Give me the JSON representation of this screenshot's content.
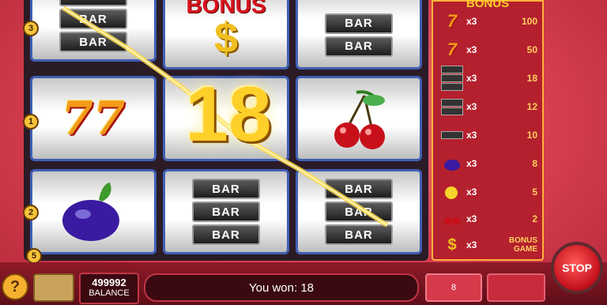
{
  "reels": {
    "bar_label": "BAR",
    "bonus_word": "BONUS",
    "dollar": "$",
    "sevens": "77",
    "win_overlay": "18"
  },
  "line_markers": [
    "3",
    "1",
    "2",
    "5"
  ],
  "paytable": {
    "title": "BONUS",
    "rows": [
      {
        "symbol": "triple-seven",
        "mult": "x3",
        "value": "100"
      },
      {
        "symbol": "seven",
        "mult": "x3",
        "value": "50"
      },
      {
        "symbol": "triple-bar",
        "mult": "x3",
        "value": "18"
      },
      {
        "symbol": "double-bar",
        "mult": "x3",
        "value": "12"
      },
      {
        "symbol": "single-bar",
        "mult": "x3",
        "value": "10"
      },
      {
        "symbol": "plum",
        "mult": "x3",
        "value": "8"
      },
      {
        "symbol": "lemon",
        "mult": "x3",
        "value": "5"
      },
      {
        "symbol": "cherry",
        "mult": "x3",
        "value": "2"
      },
      {
        "symbol": "bonus-dollar",
        "mult": "x3",
        "value": "BONUS GAME"
      }
    ]
  },
  "bottom": {
    "help_label": "?",
    "balance_value": "499992",
    "balance_label": "BALANCE",
    "message": "You won: 18",
    "bet_value": "8",
    "stop_label": "STOP"
  },
  "colors": {
    "reel_border": "#3f5fb4",
    "gold": "#ffcf2a",
    "table_bg": "#b4202e"
  }
}
